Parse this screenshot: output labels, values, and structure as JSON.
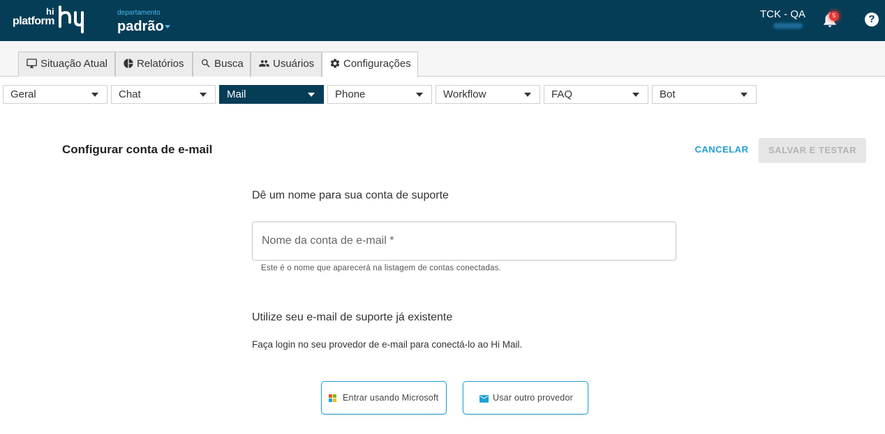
{
  "header": {
    "logo_text": "platform",
    "logo_hi": "hi",
    "dept_label": "departamento",
    "dept_name": "padrão",
    "account_name": "TCK - QA",
    "notifications_count": "5",
    "help_symbol": "?"
  },
  "tabs": [
    {
      "label": "Situação Atual",
      "icon": "monitor-icon"
    },
    {
      "label": "Relatórios",
      "icon": "pie-chart-icon"
    },
    {
      "label": "Busca",
      "icon": "search-icon"
    },
    {
      "label": "Usuários",
      "icon": "users-icon"
    },
    {
      "label": "Configurações",
      "icon": "gear-icon",
      "active": true
    }
  ],
  "subnav": [
    {
      "label": "Geral"
    },
    {
      "label": "Chat"
    },
    {
      "label": "Mail",
      "active": true
    },
    {
      "label": "Phone"
    },
    {
      "label": "Workflow"
    },
    {
      "label": "FAQ"
    },
    {
      "label": "Bot"
    }
  ],
  "page": {
    "title": "Configurar conta de e-mail",
    "cancel_label": "CANCELAR",
    "save_label": "SALVAR E TESTAR"
  },
  "form": {
    "section1_title": "Dê um nome para sua conta de suporte",
    "account_name_placeholder": "Nome da conta de e-mail *",
    "account_name_value": "",
    "account_name_helper": "Este é o nome que aparecerá na listagem de contas conectadas.",
    "section2_title": "Utilize seu e-mail de suporte já existente",
    "section2_desc": "Faça login no seu provedor de e-mail para conectá-lo ao Hi Mail.",
    "microsoft_label": "Entrar usando Microsoft",
    "other_provider_label": "Usar outro provedor"
  },
  "colors": {
    "brand_dark": "#053d57",
    "accent": "#1ea0d6",
    "badge": "#e53935"
  }
}
